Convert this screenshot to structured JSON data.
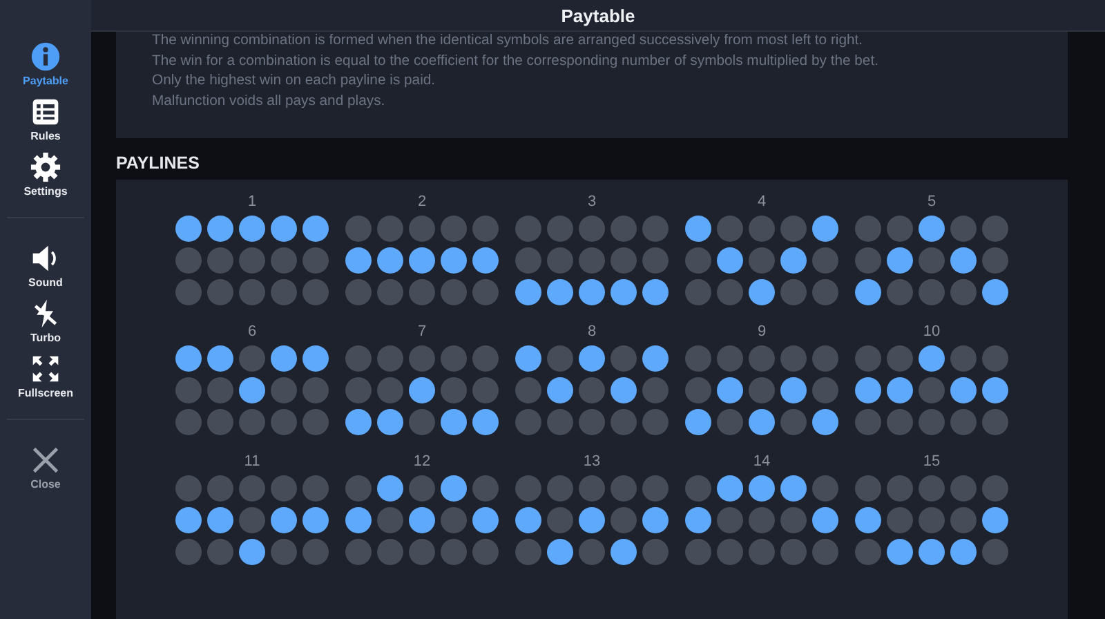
{
  "sidebar": {
    "groups": [
      {
        "items": [
          {
            "kind": "info",
            "label": "Paytable",
            "selected": true
          },
          {
            "kind": "list",
            "label": "Rules",
            "selected": false
          },
          {
            "kind": "gear",
            "label": "Settings",
            "selected": false
          }
        ]
      },
      {
        "items": [
          {
            "kind": "sound",
            "label": "Sound",
            "selected": false
          },
          {
            "kind": "turbo",
            "label": "Turbo",
            "selected": false
          },
          {
            "kind": "fullscreen",
            "label": "Fullscreen",
            "selected": false
          }
        ]
      },
      {
        "items": [
          {
            "kind": "close",
            "label": "Close",
            "selected": false
          }
        ]
      }
    ]
  },
  "header": {
    "title": "Paytable"
  },
  "rules_text": [
    "The winning combination is formed when the identical symbols are arranged successively from most left to right.",
    "The win for a combination is equal to the coefficient for the corresponding number of symbols multiplied by the bet.",
    "Only the highest win on each payline is paid.",
    "Malfunction voids all pays and plays."
  ],
  "paylines": {
    "heading": "PAYLINES",
    "items": [
      {
        "number": "1",
        "lit": [
          [
            true,
            true,
            true,
            true,
            true
          ],
          [
            false,
            false,
            false,
            false,
            false
          ],
          [
            false,
            false,
            false,
            false,
            false
          ]
        ]
      },
      {
        "number": "2",
        "lit": [
          [
            false,
            false,
            false,
            false,
            false
          ],
          [
            true,
            true,
            true,
            true,
            true
          ],
          [
            false,
            false,
            false,
            false,
            false
          ]
        ]
      },
      {
        "number": "3",
        "lit": [
          [
            false,
            false,
            false,
            false,
            false
          ],
          [
            false,
            false,
            false,
            false,
            false
          ],
          [
            true,
            true,
            true,
            true,
            true
          ]
        ]
      },
      {
        "number": "4",
        "lit": [
          [
            true,
            false,
            false,
            false,
            true
          ],
          [
            false,
            true,
            false,
            true,
            false
          ],
          [
            false,
            false,
            true,
            false,
            false
          ]
        ]
      },
      {
        "number": "5",
        "lit": [
          [
            false,
            false,
            true,
            false,
            false
          ],
          [
            false,
            true,
            false,
            true,
            false
          ],
          [
            true,
            false,
            false,
            false,
            true
          ]
        ]
      },
      {
        "number": "6",
        "lit": [
          [
            true,
            true,
            false,
            true,
            true
          ],
          [
            false,
            false,
            true,
            false,
            false
          ],
          [
            false,
            false,
            false,
            false,
            false
          ]
        ]
      },
      {
        "number": "7",
        "lit": [
          [
            false,
            false,
            false,
            false,
            false
          ],
          [
            false,
            false,
            true,
            false,
            false
          ],
          [
            true,
            true,
            false,
            true,
            true
          ]
        ]
      },
      {
        "number": "8",
        "lit": [
          [
            true,
            false,
            true,
            false,
            true
          ],
          [
            false,
            true,
            false,
            true,
            false
          ],
          [
            false,
            false,
            false,
            false,
            false
          ]
        ]
      },
      {
        "number": "9",
        "lit": [
          [
            false,
            false,
            false,
            false,
            false
          ],
          [
            false,
            true,
            false,
            true,
            false
          ],
          [
            true,
            false,
            true,
            false,
            true
          ]
        ]
      },
      {
        "number": "10",
        "lit": [
          [
            false,
            false,
            true,
            false,
            false
          ],
          [
            true,
            true,
            false,
            true,
            true
          ],
          [
            false,
            false,
            false,
            false,
            false
          ]
        ]
      },
      {
        "number": "11",
        "lit": [
          [
            false,
            false,
            false,
            false,
            false
          ],
          [
            true,
            true,
            false,
            true,
            true
          ],
          [
            false,
            false,
            true,
            false,
            false
          ]
        ]
      },
      {
        "number": "12",
        "lit": [
          [
            false,
            true,
            false,
            true,
            false
          ],
          [
            true,
            false,
            true,
            false,
            true
          ],
          [
            false,
            false,
            false,
            false,
            false
          ]
        ]
      },
      {
        "number": "13",
        "lit": [
          [
            false,
            false,
            false,
            false,
            false
          ],
          [
            true,
            false,
            true,
            false,
            true
          ],
          [
            false,
            true,
            false,
            true,
            false
          ]
        ]
      },
      {
        "number": "14",
        "lit": [
          [
            false,
            true,
            true,
            true,
            false
          ],
          [
            true,
            false,
            false,
            false,
            true
          ],
          [
            false,
            false,
            false,
            false,
            false
          ]
        ]
      },
      {
        "number": "15",
        "lit": [
          [
            false,
            false,
            false,
            false,
            false
          ],
          [
            true,
            false,
            false,
            false,
            true
          ],
          [
            false,
            true,
            true,
            true,
            false
          ]
        ]
      }
    ]
  }
}
